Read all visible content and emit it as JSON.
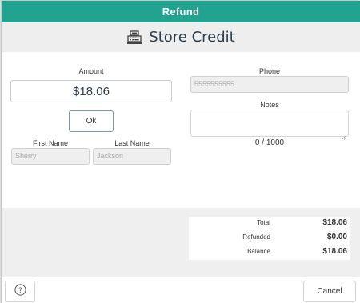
{
  "dialog": {
    "title": "Refund"
  },
  "header": {
    "title": "Store Credit",
    "icon": "cash-register-icon"
  },
  "form": {
    "amount_label": "Amount",
    "amount_value": "$18.06",
    "ok_label": "Ok",
    "first_name_label": "First Name",
    "first_name_placeholder": "Sherry",
    "last_name_label": "Last Name",
    "last_name_placeholder": "Jackson",
    "phone_label": "Phone",
    "phone_placeholder": "5555555555",
    "notes_label": "Notes",
    "notes_counter": "0 / 1000"
  },
  "totals": {
    "rows": [
      {
        "label": "Total",
        "value": "$18.06"
      },
      {
        "label": "Refunded",
        "value": "$0.00"
      },
      {
        "label": "Balance",
        "value": "$18.06"
      }
    ]
  },
  "footer": {
    "help_icon": "question-icon",
    "cancel_label": "Cancel"
  },
  "colors": {
    "titlebar": "#21a38f",
    "header_bg": "#eeeeee",
    "text_dark": "#2e3d4a"
  }
}
